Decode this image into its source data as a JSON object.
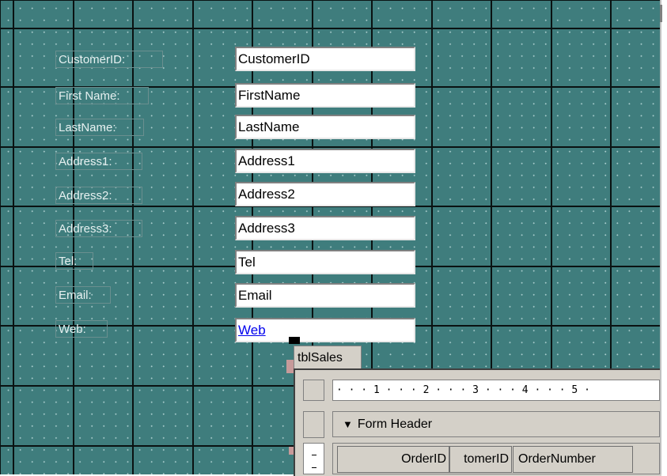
{
  "form": {
    "fields": [
      {
        "label": "CustomerID:",
        "value": "CustomerID"
      },
      {
        "label": "First Name:",
        "value": "FirstName"
      },
      {
        "label": "LastName:",
        "value": "LastName"
      },
      {
        "label": "Address1:",
        "value": "Address1"
      },
      {
        "label": "Address2:",
        "value": "Address2"
      },
      {
        "label": "Address3:",
        "value": "Address3"
      },
      {
        "label": "Tel:",
        "value": "Tel"
      },
      {
        "label": "Email:",
        "value": "Email"
      },
      {
        "label": "Web:",
        "value": "Web"
      }
    ]
  },
  "subform": {
    "tab_label": "tblSales",
    "ruler_text": "· · · 1 · · · 2 · · · 3 · · · 4 · · · 5 ·",
    "section_label": "Form Header",
    "section_icon": "down-triangle-icon",
    "columns": [
      "OrderID",
      "tomerID",
      "OrderNumber"
    ]
  },
  "colors": {
    "grid_background": "#3f7d7d",
    "link": "#0000ee",
    "panel": "#d4d0c8"
  }
}
